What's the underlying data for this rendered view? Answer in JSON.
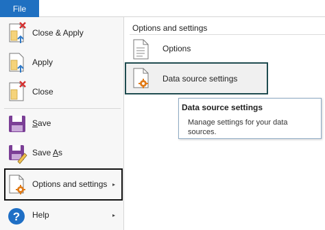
{
  "tabs": {
    "file": "File"
  },
  "menu": {
    "items": [
      {
        "id": "close-apply",
        "label": "Close & Apply",
        "icon": "close-apply-icon"
      },
      {
        "id": "apply",
        "label": "Apply",
        "icon": "apply-icon"
      },
      {
        "id": "close",
        "label": "Close",
        "icon": "close-icon"
      },
      {
        "id": "save",
        "label_pre": "",
        "label_ul": "S",
        "label_post": "ave",
        "icon": "save-icon"
      },
      {
        "id": "save-as",
        "label_pre": "Save ",
        "label_ul": "A",
        "label_post": "s",
        "icon": "save-as-icon"
      },
      {
        "id": "options-and-settings",
        "label": "Options and settings",
        "icon": "options-settings-icon",
        "has_submenu": true
      },
      {
        "id": "help",
        "label": "Help",
        "icon": "help-icon",
        "has_submenu": true
      }
    ],
    "submenu_arrow": "▸"
  },
  "submenu": {
    "title": "Options and settings",
    "items": [
      {
        "id": "options",
        "label": "Options",
        "icon": "options-document-icon"
      },
      {
        "id": "data-source-settings",
        "label": "Data source settings",
        "icon": "data-source-settings-icon"
      }
    ]
  },
  "tooltip": {
    "title": "Data source settings",
    "body": "Manage settings for your data sources."
  },
  "colors": {
    "file_tab": "#1f70c1",
    "save_purple": "#7b3f96",
    "close_red": "#d43131",
    "arrow_blue": "#2f79c6",
    "gear_orange": "#e07b19",
    "help_blue": "#1f6fc5",
    "highlight_border": "#1e4b4f"
  }
}
